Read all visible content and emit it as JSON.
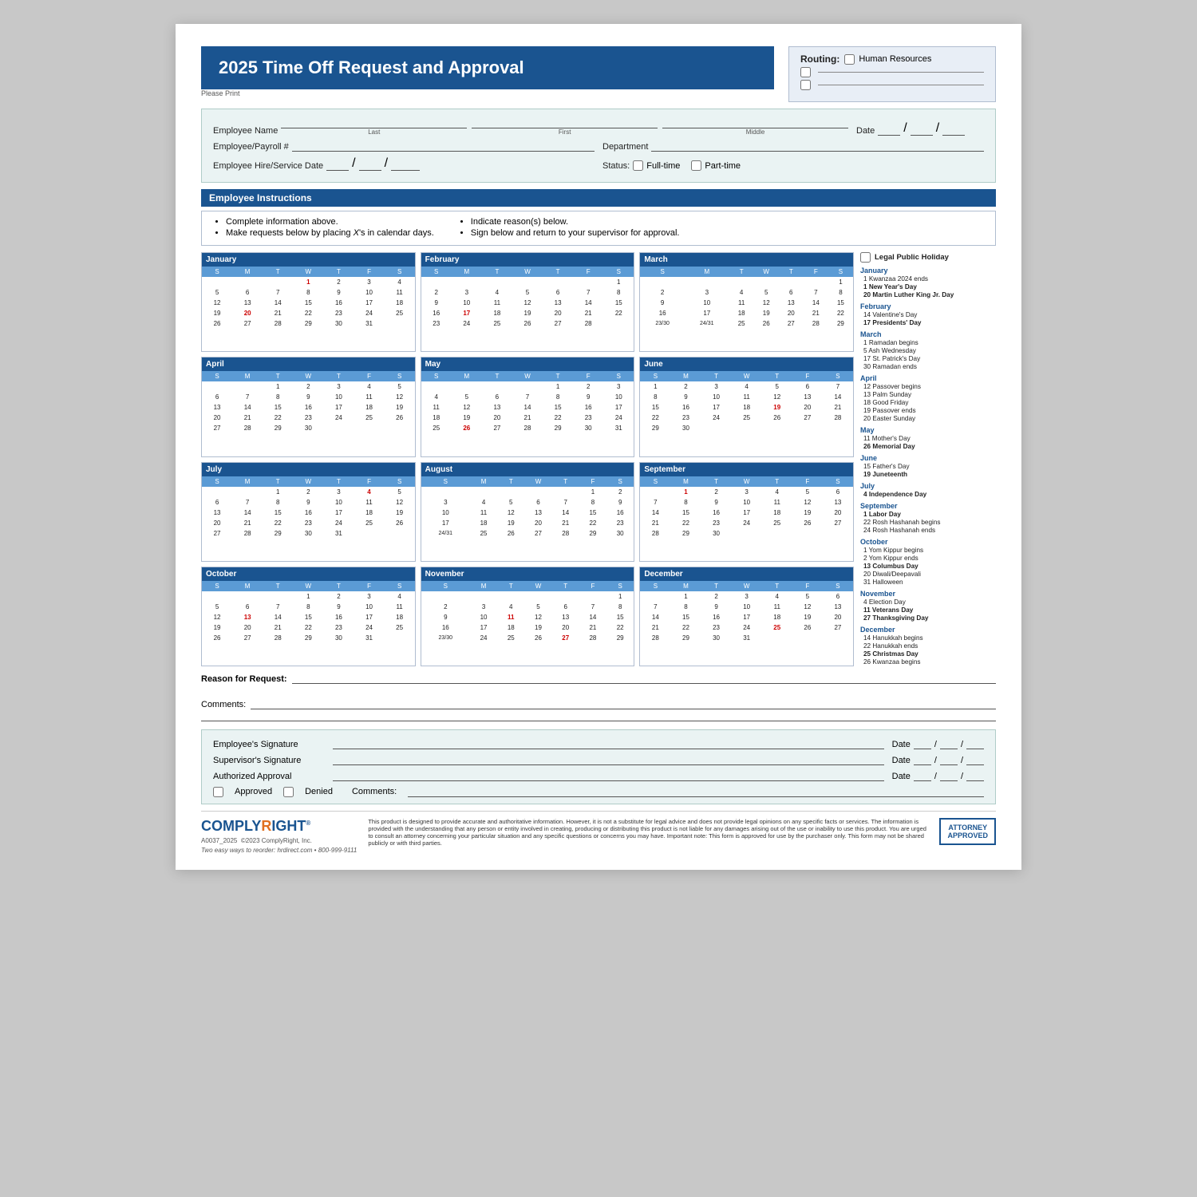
{
  "header": {
    "title": "2025 Time Off Request and Approval",
    "please_print": "Please Print",
    "routing_label": "Routing:",
    "routing_option1": "Human Resources"
  },
  "form": {
    "employee_name_label": "Employee Name",
    "last_label": "Last",
    "first_label": "First",
    "middle_label": "Middle",
    "date_label": "Date",
    "employee_payroll_label": "Employee/Payroll #",
    "department_label": "Department",
    "hire_date_label": "Employee Hire/Service Date",
    "status_label": "Status:",
    "fulltime_label": "Full-time",
    "parttime_label": "Part-time"
  },
  "instructions": {
    "header": "Employee Instructions",
    "col1": [
      "Complete information above.",
      "Make requests below by placing X's in calendar days."
    ],
    "col2": [
      "Indicate reason(s) below.",
      "Sign below and return to your supervisor for approval."
    ]
  },
  "holidays_panel": {
    "legal_holiday_label": "Legal Public Holiday",
    "months": [
      {
        "name": "January",
        "items": [
          {
            "text": "1  Kwanzaa 2024 ends",
            "bold": false
          },
          {
            "text": "1  New Year's Day",
            "bold": true
          },
          {
            "text": "20  Martin Luther King Jr. Day",
            "bold": true
          }
        ]
      },
      {
        "name": "February",
        "items": [
          {
            "text": "14  Valentine's Day",
            "bold": false
          },
          {
            "text": "17  Presidents' Day",
            "bold": true
          }
        ]
      },
      {
        "name": "March",
        "items": [
          {
            "text": "1  Ramadan begins",
            "bold": false
          },
          {
            "text": "5  Ash Wednesday",
            "bold": false
          },
          {
            "text": "17  St. Patrick's Day",
            "bold": false
          },
          {
            "text": "30  Ramadan ends",
            "bold": false
          }
        ]
      },
      {
        "name": "April",
        "items": [
          {
            "text": "12  Passover begins",
            "bold": false
          },
          {
            "text": "13  Palm Sunday",
            "bold": false
          },
          {
            "text": "18  Good Friday",
            "bold": false
          },
          {
            "text": "19  Passover ends",
            "bold": false
          },
          {
            "text": "20  Easter Sunday",
            "bold": false
          }
        ]
      },
      {
        "name": "May",
        "items": [
          {
            "text": "11  Mother's Day",
            "bold": false
          },
          {
            "text": "26  Memorial Day",
            "bold": true
          }
        ]
      },
      {
        "name": "June",
        "items": [
          {
            "text": "15  Father's Day",
            "bold": false
          },
          {
            "text": "19  Juneteenth",
            "bold": true
          }
        ]
      },
      {
        "name": "July",
        "items": [
          {
            "text": "4  Independence Day",
            "bold": true
          }
        ]
      },
      {
        "name": "September",
        "items": [
          {
            "text": "1  Labor Day",
            "bold": true
          },
          {
            "text": "22  Rosh Hashanah begins",
            "bold": false
          },
          {
            "text": "24  Rosh Hashanah ends",
            "bold": false
          }
        ]
      },
      {
        "name": "October",
        "items": [
          {
            "text": "1  Yom Kippur begins",
            "bold": false
          },
          {
            "text": "2  Yom Kippur ends",
            "bold": false
          },
          {
            "text": "13  Columbus Day",
            "bold": true
          },
          {
            "text": "20  Diwali/Deepavali",
            "bold": false
          },
          {
            "text": "31  Halloween",
            "bold": false
          }
        ]
      },
      {
        "name": "November",
        "items": [
          {
            "text": "4  Election Day",
            "bold": false
          },
          {
            "text": "11  Veterans Day",
            "bold": true
          },
          {
            "text": "27  Thanksgiving Day",
            "bold": true
          }
        ]
      },
      {
        "name": "December",
        "items": [
          {
            "text": "14  Hanukkah begins",
            "bold": false
          },
          {
            "text": "22  Hanukkah ends",
            "bold": false
          },
          {
            "text": "25  Christmas Day",
            "bold": true
          },
          {
            "text": "26  Kwanzaa begins",
            "bold": false
          }
        ]
      }
    ]
  },
  "reason": {
    "label": "Reason for Request:"
  },
  "comments": {
    "label": "Comments:"
  },
  "signatures": {
    "employee_sig": "Employee's Signature",
    "supervisor_sig": "Supervisor's Signature",
    "authorized_approval": "Authorized Approval",
    "date_label": "Date",
    "approved_label": "Approved",
    "denied_label": "Denied",
    "comments_label": "Comments:"
  },
  "footer": {
    "logo_main": "COMPLY",
    "logo_right": "RIGHT",
    "code": "A0037_2025",
    "copyright": "©2023 ComplyRight, Inc.",
    "reorder": "Two easy ways to reorder: hrdirect.com • 800-999-9111",
    "disclaimer": "This product is designed to provide accurate and authoritative information. However, it is not a substitute for legal advice and does not provide legal opinions on any specific facts or services. The information is provided with the understanding that any person or entity involved in creating, producing or distributing this product is not liable for any damages arising out of the use or inability to use this product. You are urged to consult an attorney concerning your particular situation and any specific questions or concerns you may have. Important note: This form is approved for use by the purchaser only. This form may not be shared publicly or with third parties.",
    "badge_line1": "ATTORNEY",
    "badge_line2": "APPROVED"
  },
  "calendars": [
    {
      "month": "January",
      "days_header": [
        "S",
        "M",
        "T",
        "W",
        "T",
        "F",
        "S"
      ],
      "weeks": [
        [
          "",
          "",
          "",
          "1",
          "2",
          "3",
          "4"
        ],
        [
          "5",
          "6",
          "7",
          "8",
          "9",
          "10",
          "11"
        ],
        [
          "12",
          "13",
          "14",
          "15",
          "16",
          "17",
          "18"
        ],
        [
          "19",
          "20",
          "21",
          "22",
          "23",
          "24",
          "25"
        ],
        [
          "26",
          "27",
          "28",
          "29",
          "30",
          "31",
          ""
        ]
      ],
      "bold_days": [
        "20"
      ],
      "holiday_days": [
        "1",
        "20"
      ]
    },
    {
      "month": "February",
      "days_header": [
        "S",
        "M",
        "T",
        "W",
        "T",
        "F",
        "S"
      ],
      "weeks": [
        [
          "",
          "",
          "",
          "",
          "",
          "",
          "1"
        ],
        [
          "2",
          "3",
          "4",
          "5",
          "6",
          "7",
          "8"
        ],
        [
          "9",
          "10",
          "11",
          "12",
          "13",
          "14",
          "15"
        ],
        [
          "16",
          "17",
          "18",
          "19",
          "20",
          "21",
          "22"
        ],
        [
          "23",
          "24",
          "25",
          "26",
          "27",
          "28",
          ""
        ]
      ],
      "bold_days": [
        "17"
      ],
      "holiday_days": [
        "17"
      ]
    },
    {
      "month": "March",
      "days_header": [
        "S",
        "M",
        "T",
        "W",
        "T",
        "F",
        "S"
      ],
      "weeks": [
        [
          "",
          "",
          "",
          "",
          "",
          "",
          "1"
        ],
        [
          "2",
          "3",
          "4",
          "5",
          "6",
          "7",
          "8"
        ],
        [
          "9",
          "10",
          "11",
          "12",
          "13",
          "14",
          "15"
        ],
        [
          "16",
          "17",
          "18",
          "19",
          "20",
          "21",
          "22"
        ],
        [
          "23/30",
          "24/31",
          "25",
          "26",
          "27",
          "28",
          "29"
        ]
      ],
      "bold_days": [],
      "holiday_days": []
    },
    {
      "month": "April",
      "days_header": [
        "S",
        "M",
        "T",
        "W",
        "T",
        "F",
        "S"
      ],
      "weeks": [
        [
          "",
          "",
          "1",
          "2",
          "3",
          "4",
          "5"
        ],
        [
          "6",
          "7",
          "8",
          "9",
          "10",
          "11",
          "12"
        ],
        [
          "13",
          "14",
          "15",
          "16",
          "17",
          "18",
          "19"
        ],
        [
          "20",
          "21",
          "22",
          "23",
          "24",
          "25",
          "26"
        ],
        [
          "27",
          "28",
          "29",
          "30",
          "",
          "",
          ""
        ]
      ],
      "bold_days": [],
      "holiday_days": []
    },
    {
      "month": "May",
      "days_header": [
        "S",
        "M",
        "T",
        "W",
        "T",
        "F",
        "S"
      ],
      "weeks": [
        [
          "",
          "",
          "",
          "",
          "1",
          "2",
          "3"
        ],
        [
          "4",
          "5",
          "6",
          "7",
          "8",
          "9",
          "10"
        ],
        [
          "11",
          "12",
          "13",
          "14",
          "15",
          "16",
          "17"
        ],
        [
          "18",
          "19",
          "20",
          "21",
          "22",
          "23",
          "24"
        ],
        [
          "25",
          "26",
          "27",
          "28",
          "29",
          "30",
          "31"
        ]
      ],
      "bold_days": [
        "26"
      ],
      "holiday_days": [
        "26"
      ]
    },
    {
      "month": "June",
      "days_header": [
        "S",
        "M",
        "T",
        "W",
        "T",
        "F",
        "S"
      ],
      "weeks": [
        [
          "1",
          "2",
          "3",
          "4",
          "5",
          "6",
          "7"
        ],
        [
          "8",
          "9",
          "10",
          "11",
          "12",
          "13",
          "14"
        ],
        [
          "15",
          "16",
          "17",
          "18",
          "19",
          "20",
          "21"
        ],
        [
          "22",
          "23",
          "24",
          "25",
          "26",
          "27",
          "28"
        ],
        [
          "29",
          "30",
          "",
          "",
          "",
          "",
          ""
        ]
      ],
      "bold_days": [
        "19"
      ],
      "holiday_days": [
        "19"
      ]
    },
    {
      "month": "July",
      "days_header": [
        "S",
        "M",
        "T",
        "W",
        "T",
        "F",
        "S"
      ],
      "weeks": [
        [
          "",
          "",
          "1",
          "2",
          "3",
          "4",
          "5"
        ],
        [
          "6",
          "7",
          "8",
          "9",
          "10",
          "11",
          "12"
        ],
        [
          "13",
          "14",
          "15",
          "16",
          "17",
          "18",
          "19"
        ],
        [
          "20",
          "21",
          "22",
          "23",
          "24",
          "25",
          "26"
        ],
        [
          "27",
          "28",
          "29",
          "30",
          "31",
          "",
          ""
        ]
      ],
      "bold_days": [
        "4"
      ],
      "holiday_days": [
        "4"
      ]
    },
    {
      "month": "August",
      "days_header": [
        "S",
        "M",
        "T",
        "W",
        "T",
        "F",
        "S"
      ],
      "weeks": [
        [
          "",
          "",
          "",
          "",
          "",
          "1",
          "2"
        ],
        [
          "3",
          "4",
          "5",
          "6",
          "7",
          "8",
          "9"
        ],
        [
          "10",
          "11",
          "12",
          "13",
          "14",
          "15",
          "16"
        ],
        [
          "17",
          "18",
          "19",
          "20",
          "21",
          "22",
          "23"
        ],
        [
          "24/31",
          "25",
          "26",
          "27",
          "28",
          "29",
          "30"
        ]
      ],
      "bold_days": [],
      "holiday_days": []
    },
    {
      "month": "September",
      "days_header": [
        "S",
        "M",
        "T",
        "W",
        "T",
        "F",
        "S"
      ],
      "weeks": [
        [
          "",
          "1",
          "2",
          "3",
          "4",
          "5",
          "6"
        ],
        [
          "7",
          "8",
          "9",
          "10",
          "11",
          "12",
          "13"
        ],
        [
          "14",
          "15",
          "16",
          "17",
          "18",
          "19",
          "20"
        ],
        [
          "21",
          "22",
          "23",
          "24",
          "25",
          "26",
          "27"
        ],
        [
          "28",
          "29",
          "30",
          "",
          "",
          "",
          ""
        ]
      ],
      "bold_days": [
        "1"
      ],
      "holiday_days": [
        "1"
      ]
    },
    {
      "month": "October",
      "days_header": [
        "S",
        "M",
        "T",
        "W",
        "T",
        "F",
        "S"
      ],
      "weeks": [
        [
          "",
          "",
          "",
          "1",
          "2",
          "3",
          "4"
        ],
        [
          "5",
          "6",
          "7",
          "8",
          "9",
          "10",
          "11"
        ],
        [
          "12",
          "13",
          "14",
          "15",
          "16",
          "17",
          "18"
        ],
        [
          "19",
          "20",
          "21",
          "22",
          "23",
          "24",
          "25"
        ],
        [
          "26",
          "27",
          "28",
          "29",
          "30",
          "31",
          ""
        ]
      ],
      "bold_days": [
        "13"
      ],
      "holiday_days": [
        "13"
      ]
    },
    {
      "month": "November",
      "days_header": [
        "S",
        "M",
        "T",
        "W",
        "T",
        "F",
        "S"
      ],
      "weeks": [
        [
          "",
          "",
          "",
          "",
          "",
          "",
          "1"
        ],
        [
          "2",
          "3",
          "4",
          "5",
          "6",
          "7",
          "8"
        ],
        [
          "9",
          "10",
          "11",
          "12",
          "13",
          "14",
          "15"
        ],
        [
          "16",
          "17",
          "18",
          "19",
          "20",
          "21",
          "22"
        ],
        [
          "23/30",
          "24",
          "25",
          "26",
          "27",
          "28",
          "29"
        ]
      ],
      "bold_days": [
        "11",
        "27"
      ],
      "holiday_days": [
        "11",
        "27"
      ]
    },
    {
      "month": "December",
      "days_header": [
        "S",
        "M",
        "T",
        "W",
        "T",
        "F",
        "S"
      ],
      "weeks": [
        [
          "",
          "1",
          "2",
          "3",
          "4",
          "5",
          "6"
        ],
        [
          "7",
          "8",
          "9",
          "10",
          "11",
          "12",
          "13"
        ],
        [
          "14",
          "15",
          "16",
          "17",
          "18",
          "19",
          "20"
        ],
        [
          "21",
          "22",
          "23",
          "24",
          "25",
          "26",
          "27"
        ],
        [
          "28",
          "29",
          "30",
          "31",
          "",
          "",
          ""
        ]
      ],
      "bold_days": [
        "25"
      ],
      "holiday_days": [
        "25"
      ]
    }
  ]
}
